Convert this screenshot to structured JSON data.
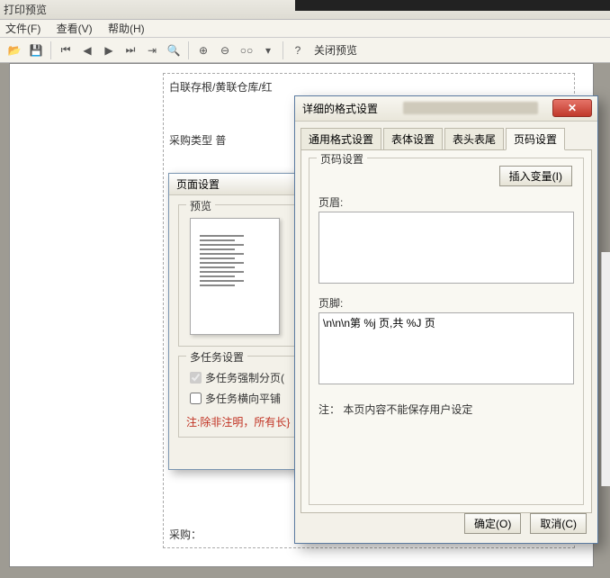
{
  "window": {
    "title": "打印预览"
  },
  "menu": {
    "file": "文件(F)",
    "view": "查看(V)",
    "help": "帮助(H)"
  },
  "toolbar": {
    "close_preview": "关闭预览"
  },
  "doc": {
    "header_line": "白联存根/黄联仓库/红",
    "sub_line": "采购类型  普",
    "footer_line": "采购："
  },
  "page_setup": {
    "title": "页面设置",
    "preview_label": "预览",
    "multitask_label": "多任务设置",
    "chk_force_break": "多任务强制分页(",
    "chk_horizontal_tile": "多任务横向平铺",
    "note": "注:除非注明，所有长}"
  },
  "detail": {
    "title": "详细的格式设置",
    "tabs": {
      "general": "通用格式设置",
      "body": "表体设置",
      "headfoot": "表头表尾",
      "pagenum": "页码设置"
    },
    "group_title": "页码设置",
    "insert_var": "插入变量(I)",
    "header_label": "页眉:",
    "header_value": "",
    "footer_label": "页脚:",
    "footer_value": "\\n\\n\\n第 %j 页,共 %J 页",
    "note": "注： 本页内容不能保存用户设定",
    "ok": "确定(O)",
    "cancel": "取消(C)"
  }
}
